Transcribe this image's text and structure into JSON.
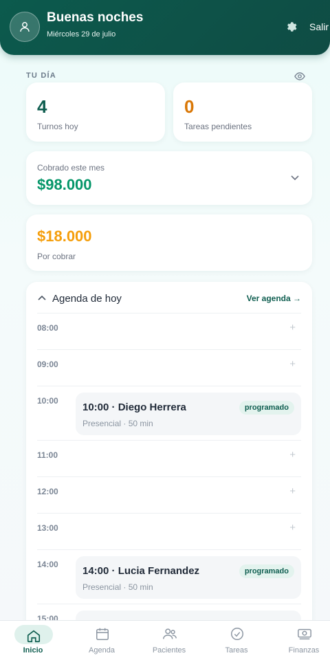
{
  "header": {
    "greeting": "Buenas noches",
    "date": "Miércoles 29 de julio",
    "logout_label": "Salir"
  },
  "summary": {
    "section_label": "TU DÍA",
    "turnos": {
      "value": "4",
      "label": "Turnos hoy"
    },
    "tareas": {
      "value": "0",
      "label": "Tareas pendientes"
    },
    "cobrado": {
      "label": "Cobrado este mes",
      "value": "$98.000"
    },
    "por_cobrar": {
      "value": "$18.000",
      "label": "Por cobrar"
    }
  },
  "agenda": {
    "title": "Agenda de hoy",
    "link": "Ver agenda →",
    "slots": [
      {
        "time": "08:00"
      },
      {
        "time": "09:00"
      },
      {
        "time": "10:00",
        "appointment": {
          "title": "10:00 · Diego Herrera",
          "subtitle": "Presencial · 50 min",
          "status": "programado"
        }
      },
      {
        "time": "11:00"
      },
      {
        "time": "12:00"
      },
      {
        "time": "13:00"
      },
      {
        "time": "14:00",
        "appointment": {
          "title": "14:00 · Lucia Fernandez",
          "subtitle": "Presencial · 50 min",
          "status": "programado"
        }
      },
      {
        "time": "15:00"
      }
    ],
    "plus_symbol": "+"
  },
  "nav": {
    "items": [
      {
        "label": "Inicio",
        "icon": "home-icon",
        "active": true
      },
      {
        "label": "Agenda",
        "icon": "calendar-icon"
      },
      {
        "label": "Pacientes",
        "icon": "users-icon"
      },
      {
        "label": "Tareas",
        "icon": "check-circle-icon"
      },
      {
        "label": "Finanzas",
        "icon": "money-icon"
      }
    ]
  },
  "colors": {
    "primary": "#0f5e50",
    "teal_number": "#0f5e50",
    "orange_number": "#d97706",
    "green_money": "#059669",
    "amber_money": "#f59e0b"
  }
}
